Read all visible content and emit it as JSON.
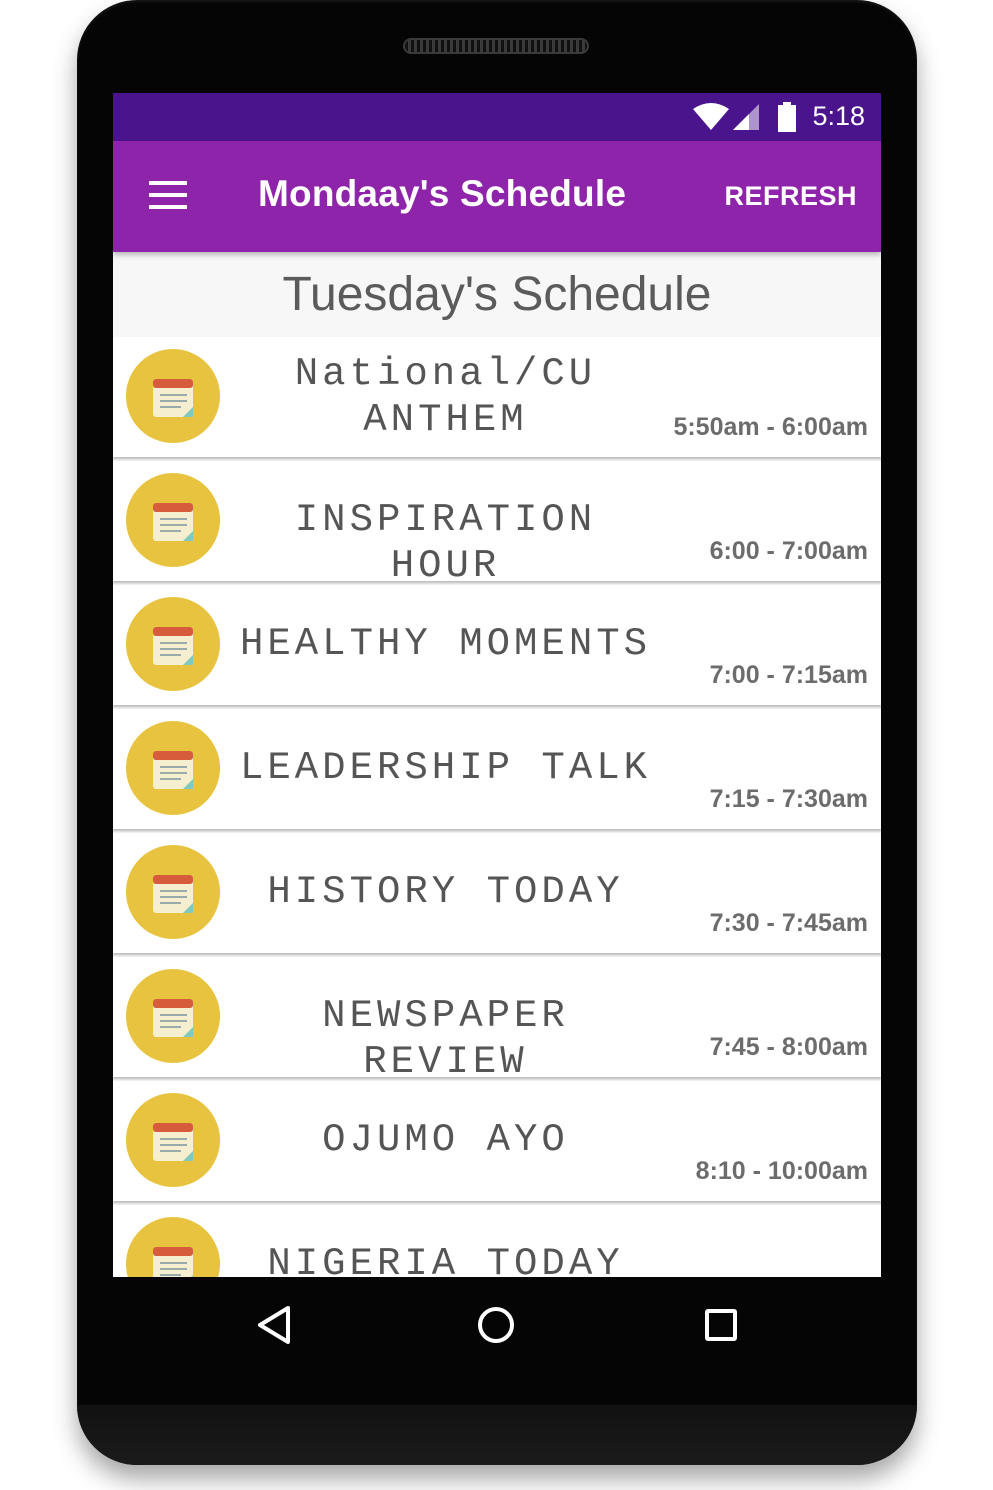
{
  "status_bar": {
    "time": "5:18"
  },
  "app_bar": {
    "title": "Mondaay's Schedule",
    "refresh_label": "REFRESH"
  },
  "section_title": "Tuesday's Schedule",
  "schedule": [
    {
      "title_line1": "National/CU",
      "title_line2": "ANTHEM",
      "time": "5:50am - 6:00am"
    },
    {
      "title_line1": "INSPIRATION HOUR",
      "time": "6:00 - 7:00am"
    },
    {
      "title_line1": "HEALTHY MOMENTS",
      "time": "7:00 - 7:15am"
    },
    {
      "title_line1": "LEADERSHIP TALK",
      "time": "7:15 - 7:30am"
    },
    {
      "title_line1": "HISTORY TODAY",
      "time": "7:30 - 7:45am"
    },
    {
      "title_line1": "NEWSPAPER REVIEW",
      "time": "7:45 - 8:00am"
    },
    {
      "title_line1": "OJUMO AYO",
      "time": "8:10 - 10:00am"
    },
    {
      "title_line1": "NIGERIA TODAY"
    }
  ],
  "icons": {
    "menu": "hamburger-menu-icon",
    "schedule_item": "notepad-calendar-icon",
    "nav_back": "triangle-back-icon",
    "nav_home": "circle-home-icon",
    "nav_recent": "square-recents-icon"
  },
  "colors": {
    "status_bar": "#4a148c",
    "app_bar": "#8e24aa",
    "avatar": "#e8c340",
    "section_text": "#5b5b5b"
  }
}
